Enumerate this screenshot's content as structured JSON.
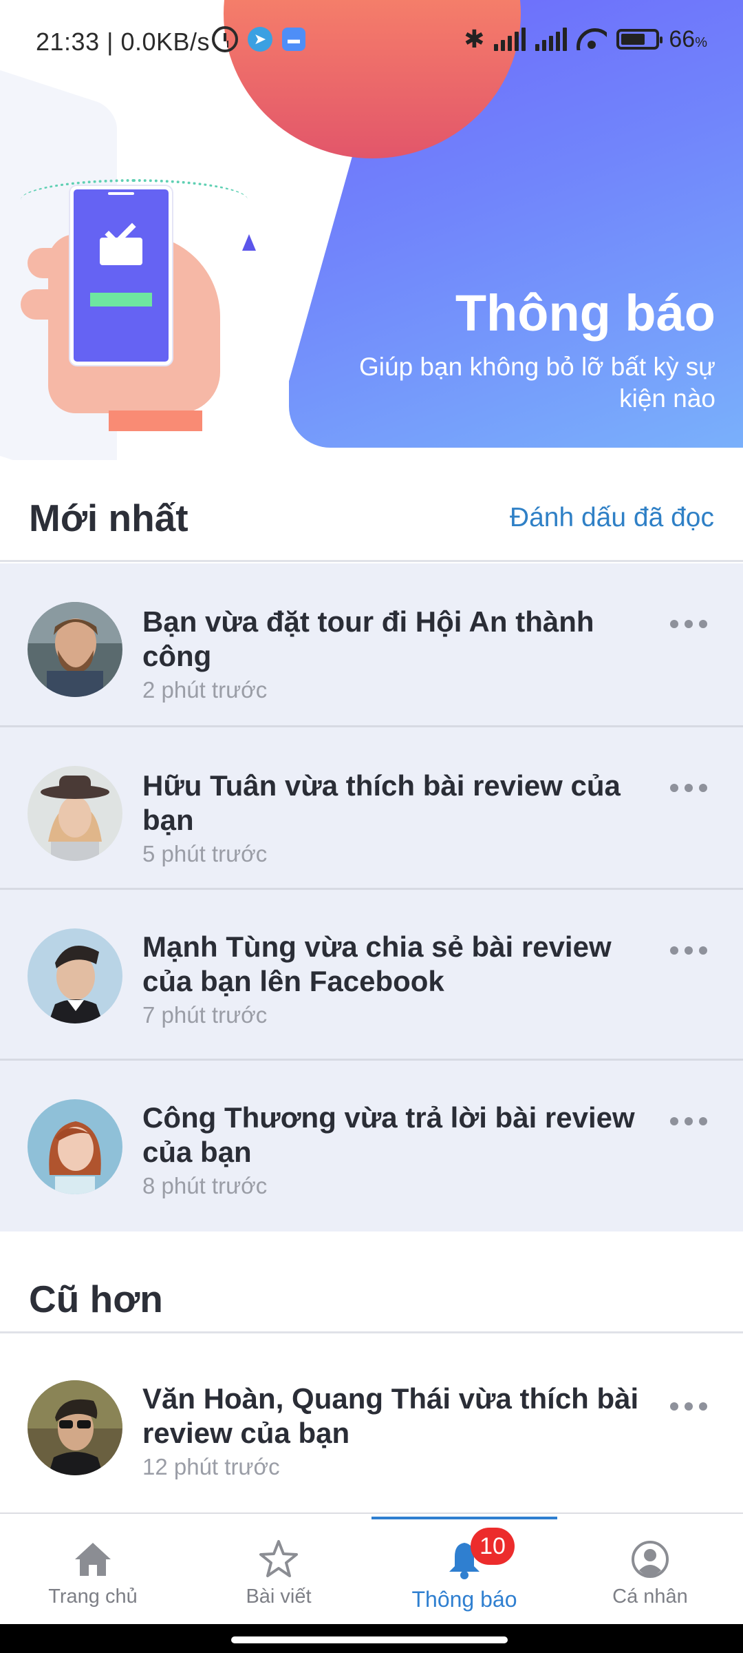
{
  "status_bar": {
    "time": "21:33 | 0.0KB/s",
    "battery_pct": "66",
    "battery_unit": "%"
  },
  "hero": {
    "title": "Thông báo",
    "subtitle": "Giúp bạn không bỏ lỡ bất kỳ sự kiện nào"
  },
  "newest": {
    "title": "Mới nhất",
    "mark_read_label": "Đánh dấu đã đọc",
    "items": [
      {
        "text": "Bạn vừa đặt tour đi Hội An thành công",
        "time": "2 phút trước"
      },
      {
        "text": "Hữu Tuân vừa thích bài review của bạn",
        "time": "5 phút trước"
      },
      {
        "text": "Mạnh Tùng vừa chia sẻ bài review của bạn lên Facebook",
        "time": "7 phút trước"
      },
      {
        "text": "Công Thương vừa trả lời bài review của bạn",
        "time": "8 phút trước"
      }
    ]
  },
  "older": {
    "title": "Cũ hơn",
    "items": [
      {
        "text": "Văn Hoàn, Quang Thái vừa thích bài review của bạn",
        "time": "12 phút trước"
      }
    ]
  },
  "bottom_nav": {
    "items": [
      {
        "label": "Trang chủ",
        "icon": "home-icon"
      },
      {
        "label": "Bài viết",
        "icon": "star-icon"
      },
      {
        "label": "Thông báo",
        "icon": "bell-icon",
        "badge": "10",
        "active": true
      },
      {
        "label": "Cá nhân",
        "icon": "user-icon"
      }
    ]
  },
  "colors": {
    "accent": "#2f7fd0",
    "badge": "#ec2c2c",
    "unread_bg": "#eceff8"
  }
}
